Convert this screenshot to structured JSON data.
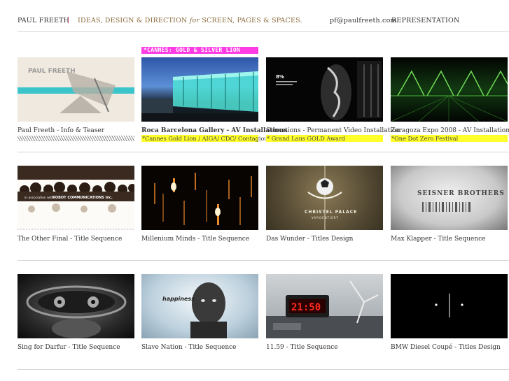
{
  "header": {
    "brand": "PAUL FREETH",
    "separator": "|",
    "tagline_part1": "IDEAS, DESIGN & DIRECTION ",
    "tagline_italic": "for",
    "tagline_part2": " SCREEN, PAGES & SPACES.",
    "email": "pf@paulfreeth.com",
    "representation": "REPRESENTATION"
  },
  "badge": "*CANNES: GOLD & SILVER LION",
  "thumb_text": {
    "t1": "PAUL FREETH",
    "t2": "8%",
    "t3_a": "in association with",
    "t3_b": "ROBOT COMMUNICATIONS Inc.",
    "t4_a": "CHRISTEL PALACE",
    "t4_b": "VARGENTIERT",
    "t5": "SEISNER BROTHERS",
    "t6": "happiness",
    "t7": "21:50"
  },
  "rows": [
    [
      {
        "title": "Paul Freeth  -  Info & Teaser",
        "award": null,
        "hatch": true
      },
      {
        "title_bold": "Roca Barcelona Gallery  -  AV Installations",
        "award": "*Cannes Gold Lion / AIGA/ CDC/ Contagious"
      },
      {
        "title": "Sensations - Permanent Video Installation",
        "award": "* Grand Laus GOLD Award"
      },
      {
        "title": "Zaragoza Expo 2008 - AV Installation",
        "award": "*One Dot Zero Festival"
      }
    ],
    [
      {
        "title": "The Other Final - Title Sequence"
      },
      {
        "title": "Millenium Minds - Title Sequence"
      },
      {
        "title": "Das Wunder - Titles Design"
      },
      {
        "title": "Max Klapper - Title Sequence"
      }
    ],
    [
      {
        "title": "Sing for Darfur - Title Sequence"
      },
      {
        "title": "Slave Nation - Title Sequence"
      },
      {
        "title": "11.59 - Title Sequence"
      },
      {
        "title": "BMW Diesel Coupé - Titles Design"
      }
    ]
  ]
}
